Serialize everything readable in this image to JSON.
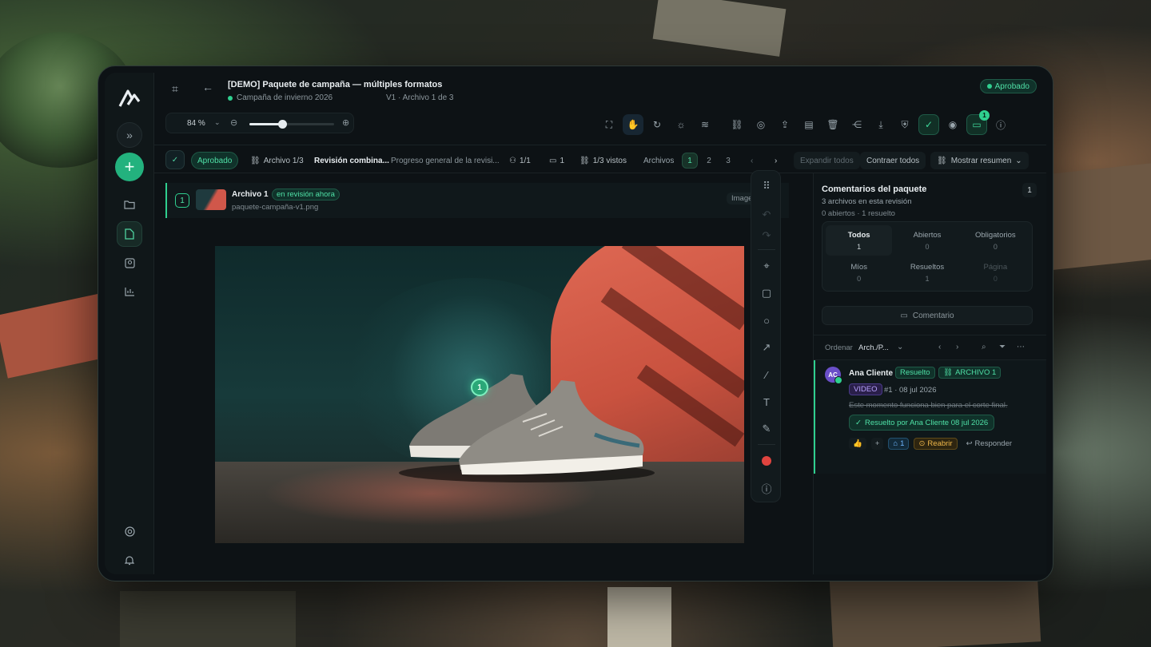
{
  "window": {
    "title": "[DEMO] Paquete de campaña — múltiples formatos",
    "campaign": "Campaña de invierno 2026",
    "version": "V1 · Archivo 1 de 3",
    "status": "Aprobado"
  },
  "zoom": {
    "value": "84 %",
    "level_percent": 84
  },
  "toolbar": {
    "notifications_count": "1"
  },
  "bar2": {
    "status": "Aprobado",
    "file": "Archivo 1/3",
    "review": "Revisión combina...",
    "progress": "Progreso general de la revisi...",
    "approvers": "1/1",
    "comments": "1",
    "viewed": "1/3 vistos",
    "files_label": "Archivos",
    "pages": [
      "1",
      "2",
      "3"
    ],
    "expand": "Expandir todos",
    "collapse": "Contraer todos",
    "summary": "Mostrar resumen"
  },
  "file": {
    "num": "1",
    "name": "Archivo 1",
    "status": "en revisión ahora",
    "path": "paquete-campaña-v1.png",
    "type": "Imagen"
  },
  "pin": "1",
  "panel": {
    "title": "Comentarios del paquete",
    "files_info": "3 archivos en esta revisión",
    "open_info": "0 abiertos · 1 resuelto",
    "count": "1",
    "filters": [
      {
        "label": "Todos",
        "count": "1"
      },
      {
        "label": "Abiertos",
        "count": "0"
      },
      {
        "label": "Obligatorios",
        "count": "0"
      },
      {
        "label": "Míos",
        "count": "0"
      },
      {
        "label": "Resueltos",
        "count": "1"
      },
      {
        "label": "Página",
        "count": "0"
      }
    ],
    "comment_button": "Comentario",
    "sort_label": "Ordenar",
    "sort_value": "Arch./P..."
  },
  "comment": {
    "initials": "AC",
    "author": "Ana Cliente",
    "status": "Resuelto",
    "file_tag": "ARCHIVO 1",
    "type_tag": "VIDEO",
    "meta": "#1 · 08 jul 2026",
    "text": "Este momento funciona bien para el corte final.",
    "resolved_by": "Resuelto por Ana Cliente 08 jul 2026",
    "tag_count": "1",
    "reopen": "Reabrir",
    "reply": "Responder"
  },
  "colors": {
    "accent": "#2fcf8f",
    "background": "#0d1215",
    "record": "#e0443f"
  }
}
